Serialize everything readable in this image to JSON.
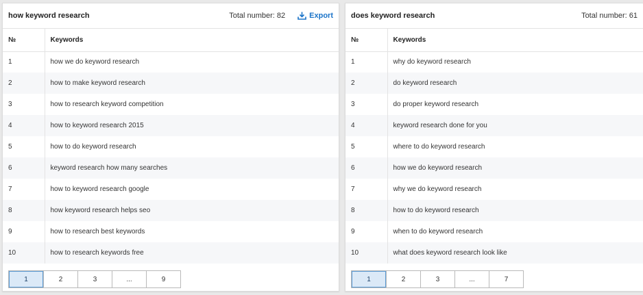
{
  "panels": [
    {
      "title": "how keyword research",
      "total": "Total number: 82",
      "export_label": "Export",
      "col_num": "№",
      "col_kw": "Keywords",
      "rows": [
        {
          "n": "1",
          "kw": "how we do keyword research"
        },
        {
          "n": "2",
          "kw": "how to make keyword research"
        },
        {
          "n": "3",
          "kw": "how to research keyword competition"
        },
        {
          "n": "4",
          "kw": "how to keyword research 2015"
        },
        {
          "n": "5",
          "kw": "how to do keyword research"
        },
        {
          "n": "6",
          "kw": "keyword research how many searches"
        },
        {
          "n": "7",
          "kw": "how to keyword research google"
        },
        {
          "n": "8",
          "kw": "how keyword research helps seo"
        },
        {
          "n": "9",
          "kw": "how to research best keywords"
        },
        {
          "n": "10",
          "kw": "how to research keywords free"
        }
      ],
      "pages": [
        "1",
        "2",
        "3",
        "...",
        "9"
      ]
    },
    {
      "title": "does keyword research",
      "total": "Total number: 61",
      "col_num": "№",
      "col_kw": "Keywords",
      "rows": [
        {
          "n": "1",
          "kw": "why do keyword research"
        },
        {
          "n": "2",
          "kw": "do keyword research"
        },
        {
          "n": "3",
          "kw": "do proper keyword research"
        },
        {
          "n": "4",
          "kw": "keyword research done for you"
        },
        {
          "n": "5",
          "kw": "where to do keyword research"
        },
        {
          "n": "6",
          "kw": "how we do keyword research"
        },
        {
          "n": "7",
          "kw": "why we do keyword research"
        },
        {
          "n": "8",
          "kw": "how to do keyword research"
        },
        {
          "n": "9",
          "kw": "when to do keyword research"
        },
        {
          "n": "10",
          "kw": "what does keyword research look like"
        }
      ],
      "pages": [
        "1",
        "2",
        "3",
        "...",
        "7"
      ]
    }
  ],
  "colors": {
    "accent": "#1a73c8",
    "active_page_bg": "#dbe9f7",
    "alt_row_bg": "#f6f7f9"
  }
}
